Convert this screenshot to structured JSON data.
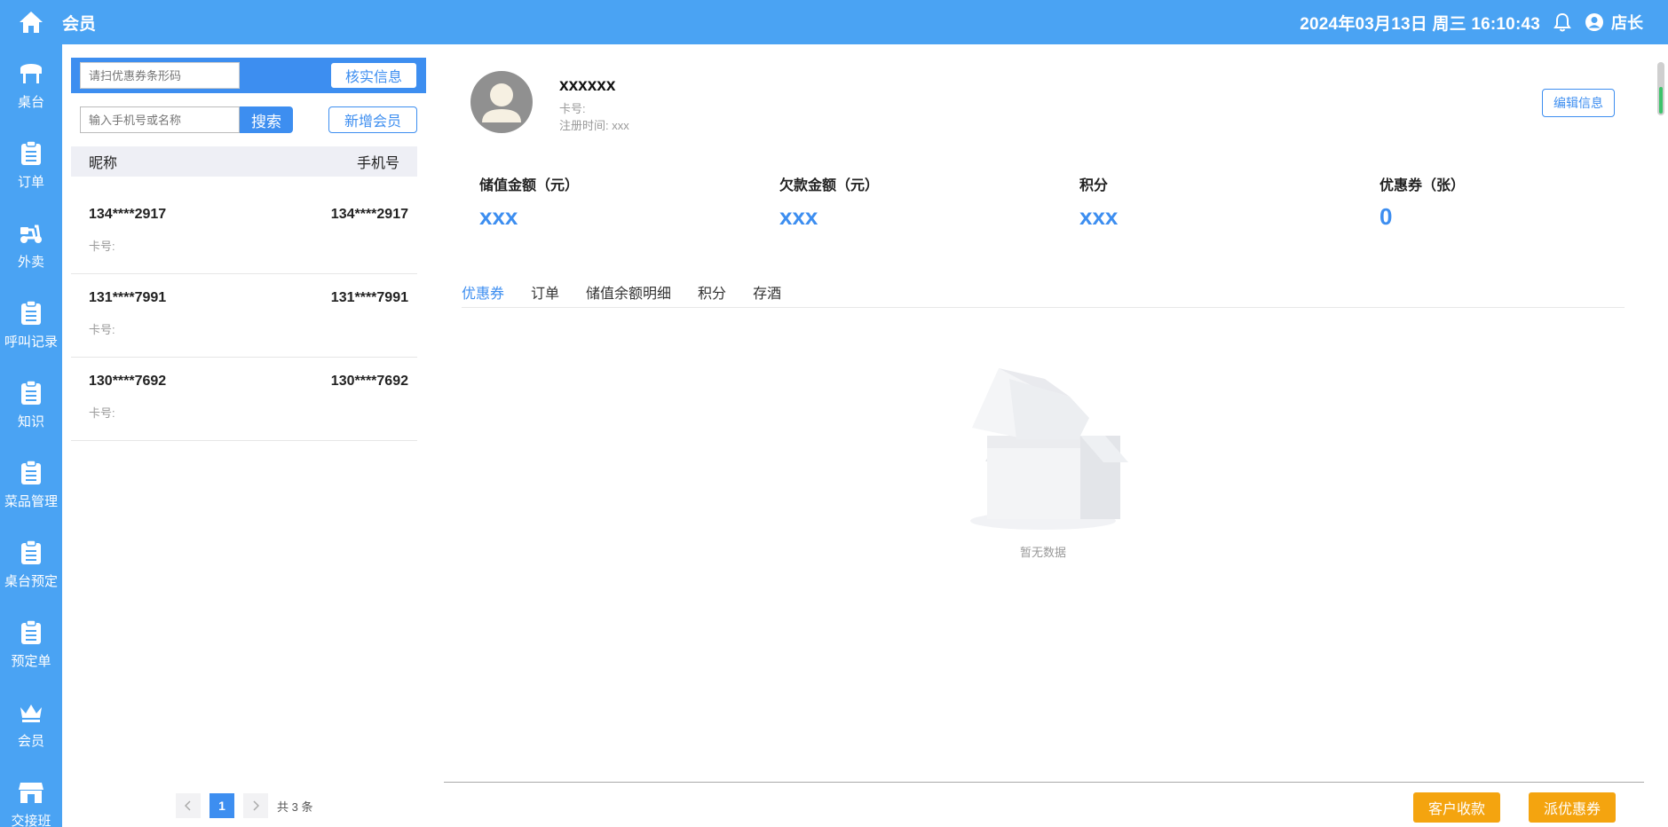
{
  "header": {
    "title": "会员",
    "datetime": "2024年03月13日 周三 16:10:43",
    "user": "店长"
  },
  "sidebar": {
    "items": [
      {
        "label": "桌台",
        "icon": "table-icon"
      },
      {
        "label": "订单",
        "icon": "clipboard-icon"
      },
      {
        "label": "外卖",
        "icon": "scooter-icon"
      },
      {
        "label": "呼叫记录",
        "icon": "clipboard-icon"
      },
      {
        "label": "知识",
        "icon": "clipboard-icon"
      },
      {
        "label": "菜品管理",
        "icon": "clipboard-icon"
      },
      {
        "label": "桌台预定",
        "icon": "clipboard-icon"
      },
      {
        "label": "预定单",
        "icon": "clipboard-icon"
      },
      {
        "label": "会员",
        "icon": "crown-icon"
      },
      {
        "label": "交接班",
        "icon": "shop-icon"
      }
    ]
  },
  "left": {
    "coupon_placeholder": "请扫优惠券条形码",
    "verify_label": "核实信息",
    "search_placeholder": "输入手机号或名称",
    "search_label": "搜索",
    "add_label": "新增会员",
    "col_nick": "昵称",
    "col_phone": "手机号",
    "members": [
      {
        "nick": "134****2917",
        "phone": "134****2917",
        "card": "卡号:"
      },
      {
        "nick": "131****7991",
        "phone": "131****7991",
        "card": "卡号:"
      },
      {
        "nick": "130****7692",
        "phone": "130****7692",
        "card": "卡号:"
      }
    ],
    "pager": {
      "current": "1",
      "total": "共 3 条"
    }
  },
  "detail": {
    "name": "xxxxxx",
    "card": "卡号:",
    "reg": "注册时间: xxx",
    "edit_label": "编辑信息",
    "stats": [
      {
        "label": "储值金额（元）",
        "value": "xxx"
      },
      {
        "label": "欠款金额（元）",
        "value": "xxx"
      },
      {
        "label": "积分",
        "value": "xxx"
      },
      {
        "label": "优惠券（张）",
        "value": "0"
      }
    ],
    "tabs": [
      "优惠券",
      "订单",
      "储值余额明细",
      "积分",
      "存酒"
    ],
    "empty_text": "暂无数据",
    "collect_label": "客户收款",
    "dispatch_label": "派优惠券"
  },
  "colors": {
    "primary": "#4aa3f3",
    "accent": "#3d8ef0",
    "orange": "#f4a40f"
  }
}
